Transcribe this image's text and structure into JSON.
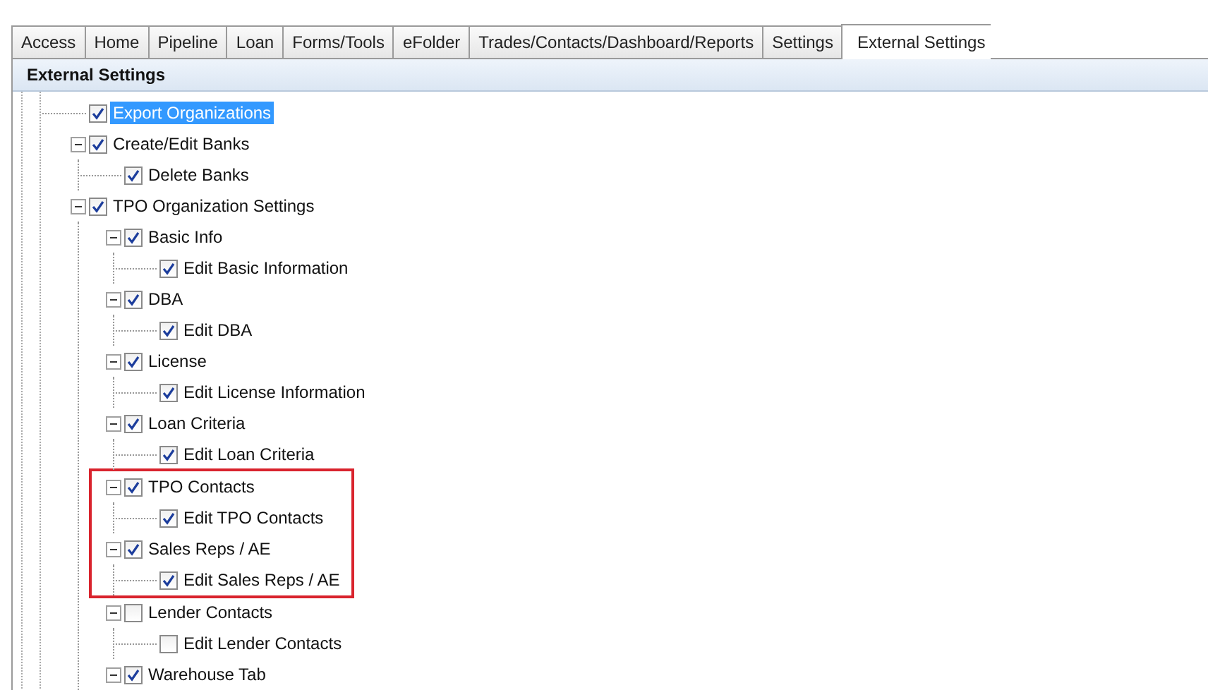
{
  "tabs": [
    {
      "label": "Access",
      "selected": false
    },
    {
      "label": "Home",
      "selected": false
    },
    {
      "label": "Pipeline",
      "selected": false
    },
    {
      "label": "Loan",
      "selected": false
    },
    {
      "label": "Forms/Tools",
      "selected": false
    },
    {
      "label": "eFolder",
      "selected": false
    },
    {
      "label": "Trades/Contacts/Dashboard/Reports",
      "selected": false
    },
    {
      "label": "Settings",
      "selected": false
    },
    {
      "label": "External Settings",
      "selected": true
    }
  ],
  "panel": {
    "title": "External Settings"
  },
  "tree": [
    {
      "label": "Export Organizations",
      "checked": true,
      "selected": true
    },
    {
      "label": "Create/Edit Banks",
      "checked": true,
      "selected": false,
      "expanded": true,
      "children": [
        {
          "label": "Delete Banks",
          "checked": true,
          "selected": false
        }
      ]
    },
    {
      "label": "TPO Organization Settings",
      "checked": true,
      "selected": false,
      "expanded": true,
      "children": [
        {
          "label": "Basic Info",
          "checked": true,
          "selected": false,
          "expanded": true,
          "children": [
            {
              "label": "Edit Basic Information",
              "checked": true,
              "selected": false
            }
          ]
        },
        {
          "label": "DBA",
          "checked": true,
          "selected": false,
          "expanded": true,
          "children": [
            {
              "label": "Edit DBA",
              "checked": true,
              "selected": false
            }
          ]
        },
        {
          "label": "License",
          "checked": true,
          "selected": false,
          "expanded": true,
          "children": [
            {
              "label": "Edit License Information",
              "checked": true,
              "selected": false
            }
          ]
        },
        {
          "label": "Loan Criteria",
          "checked": true,
          "selected": false,
          "expanded": true,
          "children": [
            {
              "label": "Edit Loan Criteria",
              "checked": true,
              "selected": false
            }
          ]
        },
        {
          "label": "TPO Contacts",
          "checked": true,
          "selected": false,
          "expanded": true,
          "highlighted": true,
          "children": [
            {
              "label": "Edit TPO Contacts",
              "checked": true,
              "selected": false
            }
          ]
        },
        {
          "label": "Sales Reps / AE",
          "checked": true,
          "selected": false,
          "expanded": true,
          "highlighted": true,
          "children": [
            {
              "label": "Edit Sales Reps / AE",
              "checked": true,
              "selected": false
            }
          ]
        },
        {
          "label": "Lender Contacts",
          "checked": false,
          "selected": false,
          "expanded": true,
          "children": [
            {
              "label": "Edit Lender Contacts",
              "checked": false,
              "selected": false
            }
          ]
        },
        {
          "label": "Warehouse Tab",
          "checked": true,
          "selected": false,
          "expanded": true
        }
      ]
    }
  ]
}
